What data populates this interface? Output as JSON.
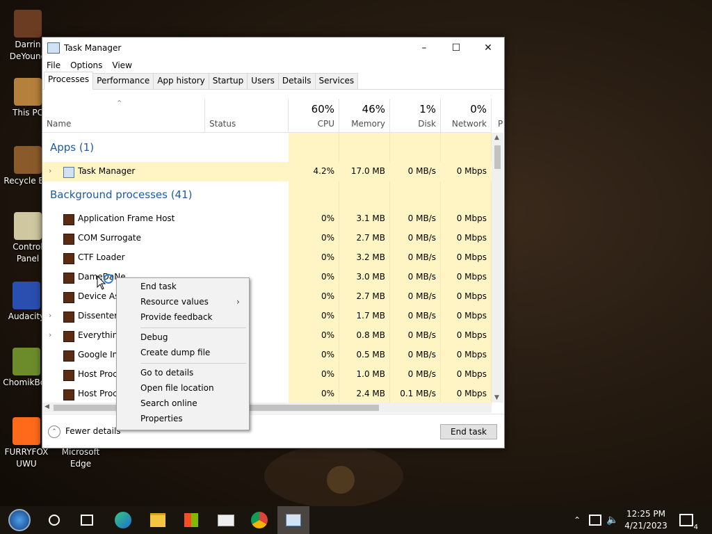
{
  "desktop_icons": [
    {
      "label": "Darrin DeYoung",
      "icon": "user-folder-icon",
      "color": "#6b3b22"
    },
    {
      "label": "This PC",
      "icon": "computer-icon",
      "color": "#b5803b"
    },
    {
      "label": "Recycle Bin",
      "icon": "recycle-bin-icon",
      "color": "#8a5a2a"
    },
    {
      "label": "Control Panel",
      "icon": "control-panel-icon",
      "color": "#cfc7a0"
    },
    {
      "label": "Audacity",
      "icon": "audacity-icon",
      "color": "#2a4fb0"
    },
    {
      "label": "ChomikBox",
      "icon": "chomikbox-icon",
      "color": "#6c8c2c"
    },
    {
      "label": "FURRYFOX UWU",
      "icon": "firefox-icon",
      "color": "#ff6a1a"
    },
    {
      "label": "Microsoft Edge",
      "icon": "edge-icon",
      "color": "#2a8fd8"
    }
  ],
  "window": {
    "title": "Task Manager",
    "menu": [
      "File",
      "Options",
      "View"
    ],
    "tabs": [
      "Processes",
      "Performance",
      "App history",
      "Startup",
      "Users",
      "Details",
      "Services"
    ],
    "active_tab": "Processes",
    "columns": {
      "name": "Name",
      "status": "Status",
      "cpu": {
        "pct": "60%",
        "label": "CPU"
      },
      "memory": {
        "pct": "46%",
        "label": "Memory"
      },
      "disk": {
        "pct": "1%",
        "label": "Disk"
      },
      "network": {
        "pct": "0%",
        "label": "Network"
      },
      "power": "P"
    },
    "group_apps": "Apps (1)",
    "group_bg": "Background processes (41)",
    "processes": [
      {
        "name": "Task Manager",
        "cpu": "4.2%",
        "mem": "17.0 MB",
        "disk": "0 MB/s",
        "net": "0 Mbps",
        "expand": true,
        "icon": "task-manager-icon"
      },
      {
        "name": "Application Frame Host",
        "cpu": "0%",
        "mem": "3.1 MB",
        "disk": "0 MB/s",
        "net": "0 Mbps",
        "expand": false,
        "icon": "app-frame-icon"
      },
      {
        "name": "COM Surrogate",
        "cpu": "0%",
        "mem": "2.7 MB",
        "disk": "0 MB/s",
        "net": "0 Mbps",
        "expand": false,
        "icon": "com-surrogate-icon"
      },
      {
        "name": "CTF Loader",
        "cpu": "0%",
        "mem": "3.2 MB",
        "disk": "0 MB/s",
        "net": "0 Mbps",
        "expand": false,
        "icon": "ctf-loader-icon"
      },
      {
        "name": "DameDaNe",
        "cpu": "0%",
        "mem": "3.0 MB",
        "disk": "0 MB/s",
        "net": "0 Mbps",
        "expand": false,
        "icon": "damedane-icon"
      },
      {
        "name": "Device As",
        "cpu": "0%",
        "mem": "2.7 MB",
        "disk": "0 MB/s",
        "net": "0 Mbps",
        "expand": false,
        "icon": "device-icon"
      },
      {
        "name": "Dissenter",
        "cpu": "0%",
        "mem": "1.7 MB",
        "disk": "0 MB/s",
        "net": "0 Mbps",
        "expand": true,
        "icon": "dissenter-icon"
      },
      {
        "name": "Everything",
        "cpu": "0%",
        "mem": "0.8 MB",
        "disk": "0 MB/s",
        "net": "0 Mbps",
        "expand": true,
        "icon": "everything-icon"
      },
      {
        "name": "Google Ins",
        "cpu": "0%",
        "mem": "0.5 MB",
        "disk": "0 MB/s",
        "net": "0 Mbps",
        "expand": false,
        "icon": "google-installer-icon"
      },
      {
        "name": "Host Proc",
        "cpu": "0%",
        "mem": "1.0 MB",
        "disk": "0 MB/s",
        "net": "0 Mbps",
        "expand": false,
        "icon": "host-process-icon"
      },
      {
        "name": "Host Proc",
        "cpu": "0%",
        "mem": "2.4 MB",
        "disk": "0.1 MB/s",
        "net": "0 Mbps",
        "expand": false,
        "icon": "host-process-icon"
      }
    ],
    "fewer_details": "Fewer details",
    "end_task": "End task"
  },
  "context_menu": {
    "items": [
      "End task",
      "Resource values",
      "Provide feedback",
      "Debug",
      "Create dump file",
      "Go to details",
      "Open file location",
      "Search online",
      "Properties"
    ]
  },
  "taskbar": {
    "time": "12:25 PM",
    "date": "4/21/2023",
    "notifications": "4",
    "apps": [
      "start-icon",
      "cortana-icon",
      "task-view-icon",
      "edge-icon",
      "file-explorer-icon",
      "store-icon",
      "mail-icon",
      "chrome-icon",
      "task-manager-icon"
    ]
  }
}
